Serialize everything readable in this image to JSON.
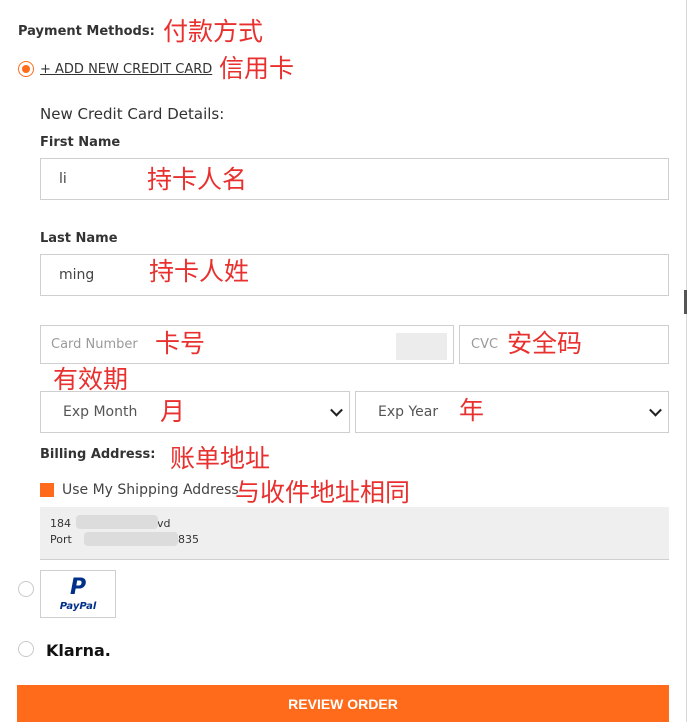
{
  "payment": {
    "title": "Payment Methods:",
    "add_card_link": "+ ADD NEW CREDIT CARD",
    "new_card_details": "New Credit Card Details:",
    "first_name": {
      "label": "First Name",
      "value": "li"
    },
    "last_name": {
      "label": "Last Name",
      "value": "ming"
    },
    "card_number": {
      "placeholder": "Card Number"
    },
    "cvc": {
      "placeholder": "CVC"
    },
    "exp_month": {
      "selected": "Exp Month"
    },
    "exp_year": {
      "selected": "Exp Year"
    },
    "billing_address": {
      "label": "Billing Address:",
      "use_shipping_label": "Use My Shipping Address",
      "line1_start": "184",
      "line1_end": "vd",
      "line2_start": "Port",
      "line2_end": "835"
    },
    "paypal": {
      "top": "P",
      "text": "PayPal"
    },
    "klarna": "Klarna.",
    "review_button": "REVIEW ORDER"
  },
  "annotations": {
    "payment_methods": "付款方式",
    "credit_card": "信用卡",
    "first_name": "持卡人名",
    "last_name": "持卡人姓",
    "card_number": "卡号",
    "cvc": "安全码",
    "expiry": "有效期",
    "month": "月",
    "year": "年",
    "billing": "账单地址",
    "same_as_shipping": "与收件地址相同"
  },
  "colors": {
    "accent": "#ff6b1a",
    "annotation": "#e8312f",
    "paypal_dark": "#003087",
    "paypal_light": "#009cde"
  }
}
